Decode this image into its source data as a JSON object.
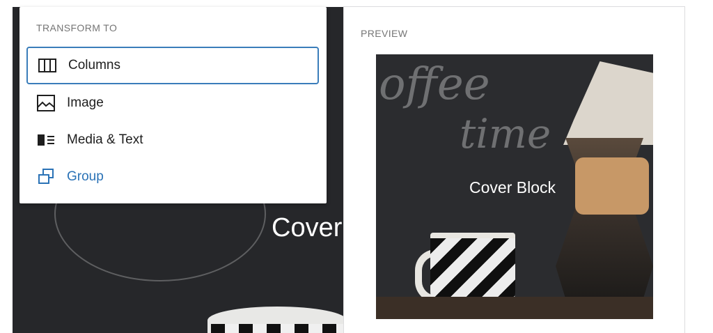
{
  "editor": {
    "cover_title": "Cover"
  },
  "transform_menu": {
    "heading": "TRANSFORM TO",
    "items": [
      {
        "label": "Columns",
        "icon": "columns-icon",
        "selected": true
      },
      {
        "label": "Image",
        "icon": "image-icon",
        "selected": false
      },
      {
        "label": "Media & Text",
        "icon": "media-text-icon",
        "selected": false
      },
      {
        "label": "Group",
        "icon": "group-icon",
        "selected": false
      }
    ]
  },
  "preview": {
    "label": "PREVIEW",
    "block_title": "Cover Block",
    "chalk_word_1": "offee",
    "chalk_word_2": "time"
  },
  "colors": {
    "accent": "#3a7dba",
    "group_link": "#2a72b6",
    "muted_heading": "#757575",
    "cover_dark": "#26272a"
  }
}
